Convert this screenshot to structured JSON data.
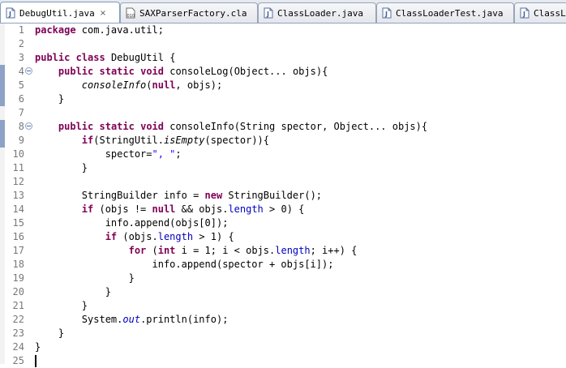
{
  "tabs": [
    {
      "label": "DebugUtil.java",
      "icon": "java-file-icon",
      "active": true,
      "close": "×"
    },
    {
      "label": "SAXParserFactory.cla",
      "icon": "class-file-icon",
      "active": false
    },
    {
      "label": "ClassLoader.java",
      "icon": "java-file-icon",
      "active": false
    },
    {
      "label": "ClassLoaderTest.java",
      "icon": "java-file-icon",
      "active": false
    },
    {
      "label": "ClassL",
      "icon": "java-file-icon",
      "active": false
    }
  ],
  "colors": {
    "keyword": "#7f0055",
    "field": "#0000c0",
    "string": "#2a00ff",
    "line_number": "#787878",
    "ruler_highlight": "#8ea1c7"
  },
  "editor": {
    "lines": [
      {
        "num": "1",
        "tokens": [
          {
            "t": "package",
            "c": "kw"
          },
          {
            "t": " com.java.util;"
          }
        ]
      },
      {
        "num": "2",
        "tokens": []
      },
      {
        "num": "3",
        "tokens": [
          {
            "t": "public",
            "c": "kw"
          },
          {
            "t": " "
          },
          {
            "t": "class",
            "c": "kw"
          },
          {
            "t": " DebugUtil {"
          }
        ]
      },
      {
        "num": "4",
        "fold": true,
        "tokens": [
          {
            "t": "    "
          },
          {
            "t": "public",
            "c": "kw"
          },
          {
            "t": " "
          },
          {
            "t": "static",
            "c": "kw"
          },
          {
            "t": " "
          },
          {
            "t": "void",
            "c": "kw"
          },
          {
            "t": " consoleLog(Object... objs){"
          }
        ]
      },
      {
        "num": "5",
        "tokens": [
          {
            "t": "        "
          },
          {
            "t": "consoleInfo",
            "c": "it"
          },
          {
            "t": "("
          },
          {
            "t": "null",
            "c": "kw"
          },
          {
            "t": ", objs);"
          }
        ]
      },
      {
        "num": "6",
        "tokens": [
          {
            "t": "    }"
          }
        ]
      },
      {
        "num": "7",
        "tokens": []
      },
      {
        "num": "8",
        "fold": true,
        "tokens": [
          {
            "t": "    "
          },
          {
            "t": "public",
            "c": "kw"
          },
          {
            "t": " "
          },
          {
            "t": "static",
            "c": "kw"
          },
          {
            "t": " "
          },
          {
            "t": "void",
            "c": "kw"
          },
          {
            "t": " consoleInfo(String spector, Object... objs){"
          }
        ]
      },
      {
        "num": "9",
        "tokens": [
          {
            "t": "        "
          },
          {
            "t": "if",
            "c": "kw"
          },
          {
            "t": "(StringUtil."
          },
          {
            "t": "isEmpty",
            "c": "it"
          },
          {
            "t": "(spector)){"
          }
        ]
      },
      {
        "num": "10",
        "tokens": [
          {
            "t": "            spector="
          },
          {
            "t": "\", \"",
            "c": "str"
          },
          {
            "t": ";"
          }
        ]
      },
      {
        "num": "11",
        "tokens": [
          {
            "t": "        }"
          }
        ]
      },
      {
        "num": "12",
        "tokens": []
      },
      {
        "num": "13",
        "tokens": [
          {
            "t": "        StringBuilder info = "
          },
          {
            "t": "new",
            "c": "kw"
          },
          {
            "t": " StringBuilder();"
          }
        ]
      },
      {
        "num": "14",
        "tokens": [
          {
            "t": "        "
          },
          {
            "t": "if",
            "c": "kw"
          },
          {
            "t": " (objs != "
          },
          {
            "t": "null",
            "c": "kw"
          },
          {
            "t": " && objs."
          },
          {
            "t": "length",
            "c": "fld"
          },
          {
            "t": " > 0) {"
          }
        ]
      },
      {
        "num": "15",
        "tokens": [
          {
            "t": "            info.append(objs[0]);"
          }
        ]
      },
      {
        "num": "16",
        "tokens": [
          {
            "t": "            "
          },
          {
            "t": "if",
            "c": "kw"
          },
          {
            "t": " (objs."
          },
          {
            "t": "length",
            "c": "fld"
          },
          {
            "t": " > 1) {"
          }
        ]
      },
      {
        "num": "17",
        "tokens": [
          {
            "t": "                "
          },
          {
            "t": "for",
            "c": "kw"
          },
          {
            "t": " ("
          },
          {
            "t": "int",
            "c": "kw"
          },
          {
            "t": " i = 1; i < objs."
          },
          {
            "t": "length",
            "c": "fld"
          },
          {
            "t": "; i++) {"
          }
        ]
      },
      {
        "num": "18",
        "tokens": [
          {
            "t": "                    info.append(spector + objs[i]);"
          }
        ]
      },
      {
        "num": "19",
        "tokens": [
          {
            "t": "                }"
          }
        ]
      },
      {
        "num": "20",
        "tokens": [
          {
            "t": "            }"
          }
        ]
      },
      {
        "num": "21",
        "tokens": [
          {
            "t": "        }"
          }
        ]
      },
      {
        "num": "22",
        "tokens": [
          {
            "t": "        System."
          },
          {
            "t": "out",
            "c": "fldi"
          },
          {
            "t": ".println(info);"
          }
        ]
      },
      {
        "num": "23",
        "tokens": [
          {
            "t": "    }"
          }
        ]
      },
      {
        "num": "24",
        "tokens": [
          {
            "t": "}"
          }
        ]
      },
      {
        "num": "25",
        "caret": true,
        "tokens": []
      }
    ]
  }
}
